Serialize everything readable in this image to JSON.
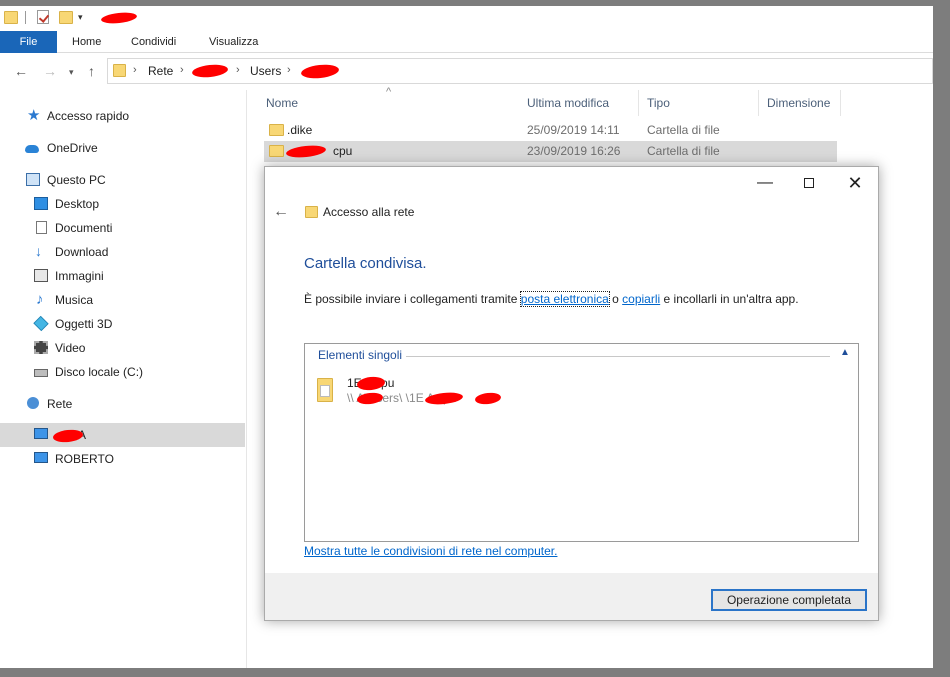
{
  "titlebar": {
    "title": "",
    "qa_dropdown": "▾"
  },
  "ribbon": {
    "tabs": [
      {
        "label": "File"
      },
      {
        "label": "Home"
      },
      {
        "label": "Condividi"
      },
      {
        "label": "Visualizza"
      }
    ]
  },
  "address": {
    "breadcrumbs": [
      {
        "label": "Rete"
      },
      {
        "label": ""
      },
      {
        "label": "Users"
      },
      {
        "label": ""
      }
    ],
    "separator": "›"
  },
  "nav": {
    "items": [
      {
        "label": "Accesso rapido",
        "icon": "star-icon"
      },
      {
        "label": "OneDrive",
        "icon": "cloud-icon"
      },
      {
        "label": "Questo PC",
        "icon": "computer-icon"
      },
      {
        "label": "Desktop",
        "icon": "desktop-icon"
      },
      {
        "label": "Documenti",
        "icon": "documents-icon"
      },
      {
        "label": "Download",
        "icon": "download-icon"
      },
      {
        "label": "Immagini",
        "icon": "pictures-icon"
      },
      {
        "label": "Musica",
        "icon": "music-icon"
      },
      {
        "label": "Oggetti 3D",
        "icon": "objects-3d-icon"
      },
      {
        "label": "Video",
        "icon": "video-icon"
      },
      {
        "label": "Disco locale (C:)",
        "icon": "drive-icon"
      },
      {
        "label": "Rete",
        "icon": "network-icon"
      },
      {
        "label": "A",
        "icon": "computer-icon"
      },
      {
        "label": "ROBERTO",
        "icon": "computer-icon"
      }
    ]
  },
  "filelist": {
    "columns": [
      "Nome",
      "Ultima modifica",
      "Tipo",
      "Dimensione"
    ],
    "sort_indicator": "^",
    "rows": [
      {
        "name": ".dike",
        "modified": "25/09/2019 14:11",
        "type": "Cartella di file"
      },
      {
        "name": "cpu",
        "modified": "23/09/2019 16:26",
        "type": "Cartella di file"
      }
    ]
  },
  "dialog": {
    "title": "Accesso alla rete",
    "heading": "Cartella condivisa.",
    "text_prefix": "È possibile inviare i collegamenti tramite ",
    "link_email": "posta elettronica",
    "text_mid": " o ",
    "link_copy": "copiarli",
    "text_suffix": " e incollarli in un'altra app.",
    "group_title": "Elementi singoli",
    "item_name": "1E   A  cpu",
    "item_path": "\\\\   A\\Users\\         \\1E   A  cpu",
    "show_all_link": "Mostra tutte le condivisioni di rete nel computer.",
    "done_button": "Operazione completata",
    "controls": {
      "minimize": "—",
      "close": "✕",
      "back": "←"
    }
  },
  "colors": {
    "accent": "#1a66b8",
    "link": "#0066cc",
    "heading": "#1f4e9a",
    "selection": "#d9d9d9",
    "redaction": "#ff0000"
  }
}
